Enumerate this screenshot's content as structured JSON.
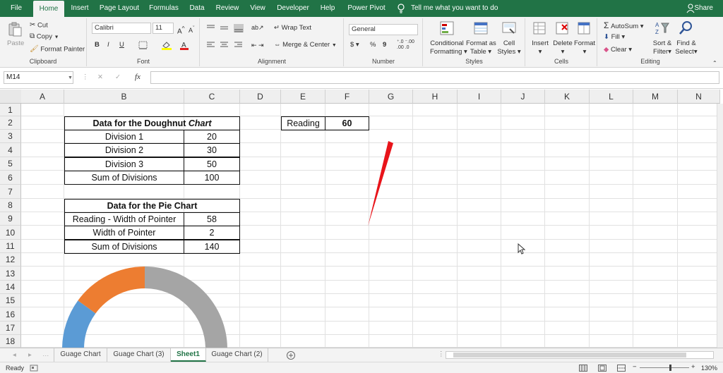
{
  "ribbon_tabs": [
    "File",
    "Home",
    "Insert",
    "Page Layout",
    "Formulas",
    "Data",
    "Review",
    "View",
    "Developer",
    "Help",
    "Power Pivot"
  ],
  "tell_me": "Tell me what you want to do",
  "share": "Share",
  "clipboard": {
    "paste": "Paste",
    "cut": "Cut",
    "copy": "Copy",
    "format_painter": "Format Painter",
    "label": "Clipboard"
  },
  "font": {
    "name": "Calibri",
    "size": "11",
    "label": "Font",
    "bold": "B",
    "italic": "I",
    "underline": "U"
  },
  "alignment": {
    "wrap": "Wrap Text",
    "merge": "Merge & Center",
    "label": "Alignment"
  },
  "number": {
    "format": "General",
    "label": "Number",
    "percent": "%",
    "comma": "9"
  },
  "styles": {
    "conditional": [
      "Conditional",
      "Formatting"
    ],
    "format_table": [
      "Format as",
      "Table"
    ],
    "cell_styles": [
      "Cell",
      "Styles"
    ],
    "label": "Styles"
  },
  "cells": {
    "insert": "Insert",
    "delete": "Delete",
    "format": "Format",
    "label": "Cells"
  },
  "editing": {
    "autosum": "AutoSum",
    "fill": "Fill",
    "clear": "Clear",
    "sort": [
      "Sort &",
      "Filter"
    ],
    "find": [
      "Find &",
      "Select"
    ],
    "label": "Editing"
  },
  "formula_bar": {
    "name_box": "M14",
    "fx": "fx",
    "value": ""
  },
  "columns": [
    "A",
    "B",
    "C",
    "D",
    "E",
    "F",
    "G",
    "H",
    "I",
    "J",
    "K",
    "L",
    "M",
    "N"
  ],
  "rows": [
    "1",
    "2",
    "3",
    "4",
    "5",
    "6",
    "7",
    "8",
    "9",
    "10",
    "11",
    "12",
    "13",
    "14",
    "15",
    "16",
    "17",
    "18"
  ],
  "doughnut_table": {
    "title_plain": "Data for the Doughnut ",
    "title_italic": "Chart",
    "rows": [
      [
        "Division 1",
        "20"
      ],
      [
        "Division 2",
        "30"
      ],
      [
        "Division 3",
        "50"
      ],
      [
        "Sum of Divisions",
        "100"
      ]
    ]
  },
  "pie_table": {
    "title": "Data for the Pie Chart",
    "rows": [
      [
        "Reading - Width of Pointer",
        "58"
      ],
      [
        "Width of Pointer",
        "2"
      ],
      [
        "Sum of Divisions",
        "140"
      ]
    ]
  },
  "reading": {
    "label": "Reading",
    "value": "60"
  },
  "gauge_colors": {
    "division1": "#5b9bd5",
    "division2": "#ed7d31",
    "division3": "#a5a5a5",
    "pointer": "#e8141a"
  },
  "sheet_tabs": [
    "Guage Chart",
    "Guage Chart (3)",
    "Sheet1",
    "Guage Chart (2)"
  ],
  "active_sheet": "Sheet1",
  "status": {
    "ready": "Ready",
    "zoom": "130%"
  }
}
